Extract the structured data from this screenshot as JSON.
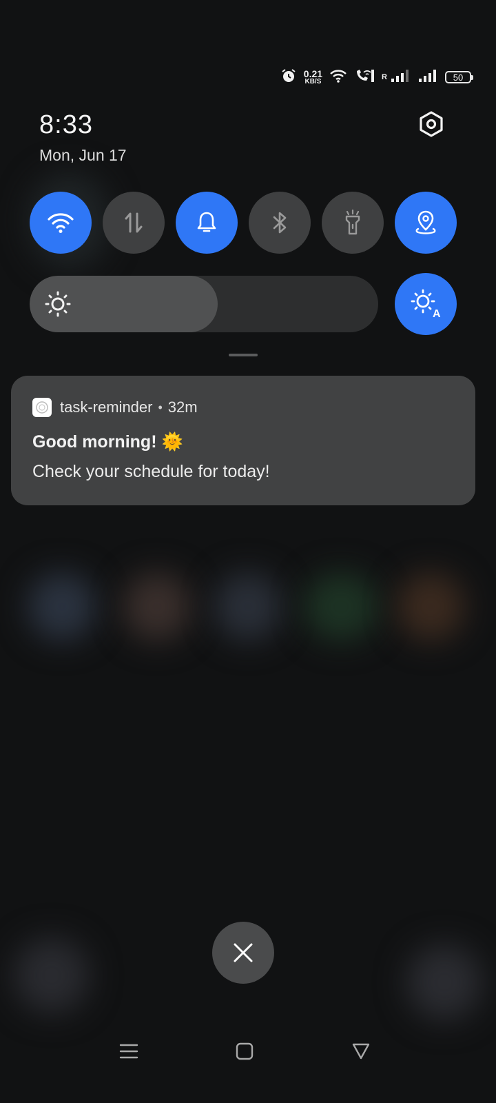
{
  "status_bar": {
    "net_speed_value": "0.21",
    "net_speed_unit": "KB/S",
    "roaming_indicator": "R",
    "battery": "50"
  },
  "header": {
    "time": "8:33",
    "date": "Mon, Jun 17"
  },
  "quick_tiles": [
    {
      "name": "wifi",
      "active": true
    },
    {
      "name": "mobile-data",
      "active": false
    },
    {
      "name": "sound",
      "active": true
    },
    {
      "name": "bluetooth",
      "active": false
    },
    {
      "name": "flashlight",
      "active": false
    },
    {
      "name": "location",
      "active": true
    }
  ],
  "brightness": {
    "level_percent": 54,
    "auto": true
  },
  "notification": {
    "app_name": "task-reminder",
    "separator": "•",
    "time_ago": "32m",
    "title": "Good morning! 🌞",
    "body": "Check your schedule for today!"
  },
  "colors": {
    "accent": "#2f77f6",
    "tile_off": "#3f4041",
    "card": "#414243",
    "background": "#111213"
  }
}
